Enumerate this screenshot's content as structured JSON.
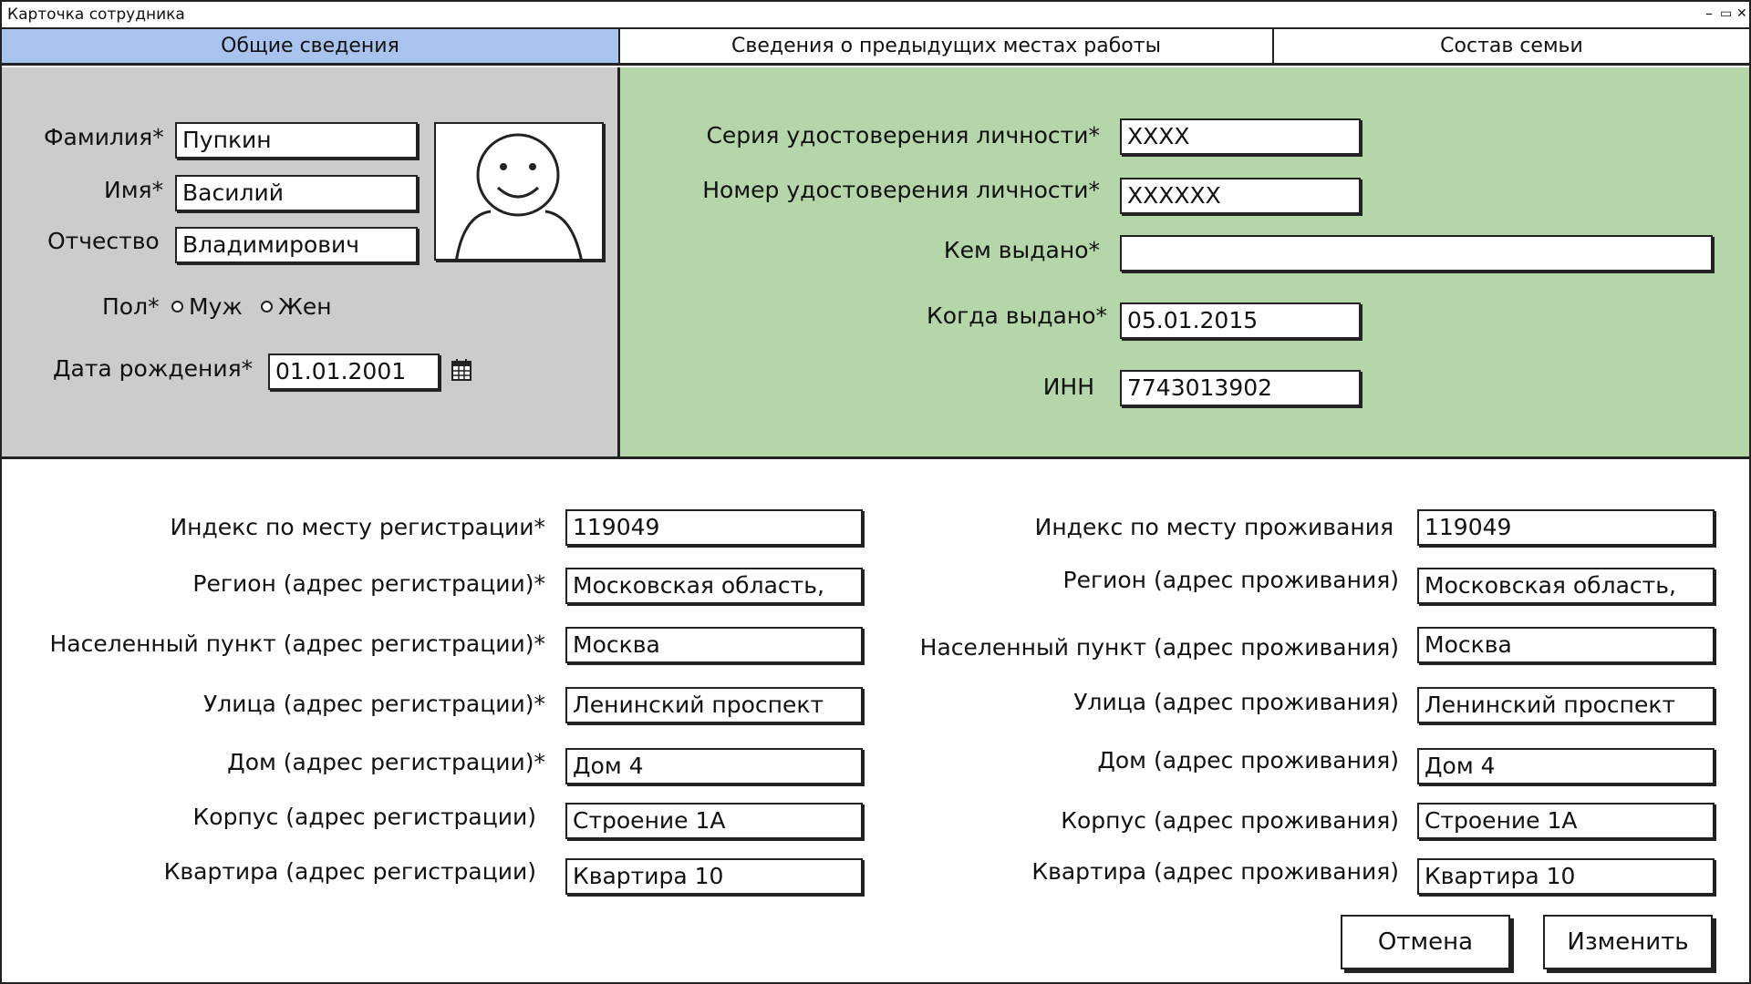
{
  "window": {
    "title": "Карточка сотрудника",
    "controls": {
      "minimize": "–",
      "maximize": "▭",
      "close": "✕"
    }
  },
  "tabs": [
    {
      "label": "Общие сведения",
      "active": true
    },
    {
      "label": "Сведения о предыдущих местах работы",
      "active": false
    },
    {
      "label": "Состав семьи",
      "active": false
    }
  ],
  "personal": {
    "surname_label": "Фамилия*",
    "surname_value": "Пупкин",
    "name_label": "Имя*",
    "name_value": "Василий",
    "patronymic_label": "Отчество",
    "patronymic_value": "Владимирович",
    "gender_label": "Пол*",
    "gender_male": "Муж",
    "gender_female": "Жен",
    "birth_label": "Дата рождения*",
    "birth_value": "01.01.2001"
  },
  "document": {
    "series_label": "Серия удостоверения личности*",
    "series_value": "XXXX",
    "number_label": "Номер удостоверения личности*",
    "number_value": "XXXXXX",
    "issued_by_label": "Кем выдано*",
    "issued_by_value": "",
    "issued_date_label": "Когда выдано*",
    "issued_date_value": "05.01.2015",
    "inn_label": "ИНН",
    "inn_value": "7743013902"
  },
  "registration": {
    "index_label": "Индекс по месту регистрации*",
    "index_value": "119049",
    "region_label": "Регион (адрес регистрации)*",
    "region_value": "Московская область,",
    "city_label": "Населенный пункт (адрес регистрации)*",
    "city_value": "Москва",
    "street_label": "Улица (адрес регистрации)*",
    "street_value": "Ленинский проспект",
    "house_label": "Дом (адрес регистрации)*",
    "house_value": "Дом 4",
    "building_label": "Корпус (адрес регистрации)",
    "building_value": "Строение 1А",
    "flat_label": "Квартира (адрес регистрации)",
    "flat_value": "Квартира 10"
  },
  "residence": {
    "index_label": "Индекс по месту проживания",
    "index_value": "119049",
    "region_label": "Регион (адрес проживания)",
    "region_value": "Московская область,",
    "city_label": "Населенный пункт (адрес проживания)",
    "city_value": "Москва",
    "street_label": "Улица (адрес проживания)",
    "street_value": "Ленинский проспект",
    "house_label": "Дом (адрес проживания)",
    "house_value": "Дом 4",
    "building_label": "Корпус (адрес проживания)",
    "building_value": "Строение 1А",
    "flat_label": "Квартира (адрес проживания)",
    "flat_value": "Квартира 10"
  },
  "actions": {
    "cancel_label": "Отмена",
    "change_label": "Изменить"
  },
  "colors": {
    "active_tab": "#a8c4ee",
    "left_panel": "#cccccc",
    "right_panel": "#b5d6a8"
  },
  "icons": {
    "calendar": "calendar-icon",
    "photo": "avatar-placeholder-icon"
  }
}
